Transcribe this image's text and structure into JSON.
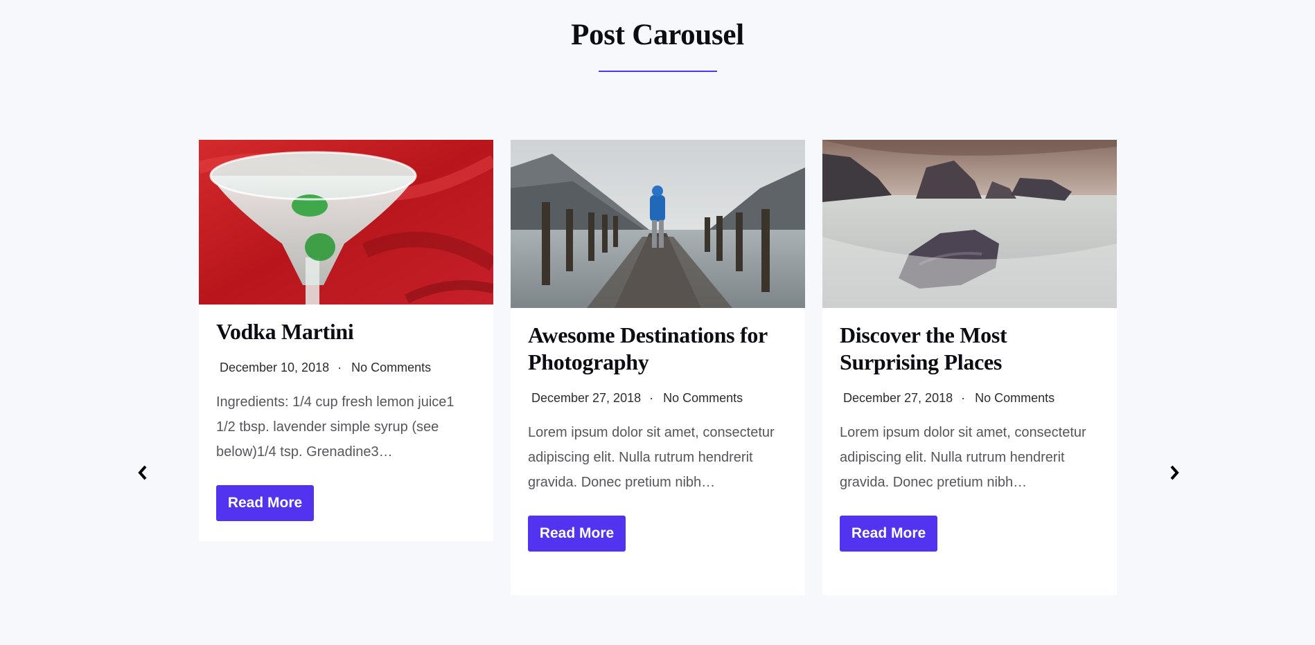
{
  "section": {
    "title": "Post Carousel"
  },
  "navigation": {
    "prev_icon": "chevron-left-icon",
    "next_icon": "chevron-right-icon"
  },
  "posts": [
    {
      "title": "Vodka Martini",
      "date": "December 10, 2018",
      "separator": "·",
      "comments": "No Comments",
      "excerpt": "Ingredients: 1/4 cup fresh lemon juice1 1/2 tbsp. lavender simple syrup (see below)1/4 tsp. Grenadine3…",
      "button_label": "Read More",
      "image": "martini-glass-photo"
    },
    {
      "title": "Awesome Destinations for Photography",
      "date": "December 27, 2018",
      "separator": "·",
      "comments": "No Comments",
      "excerpt": "Lorem ipsum dolor sit amet, consectetur adipiscing elit. Nulla rutrum hendrerit gravida. Donec pretium nibh…",
      "button_label": "Read More",
      "image": "lake-pier-photo"
    },
    {
      "title": "Discover the Most Surprising Places",
      "date": "December 27, 2018",
      "separator": "·",
      "comments": "No Comments",
      "excerpt": "Lorem ipsum dolor sit amet, consectetur adipiscing elit. Nulla rutrum hendrerit gravida. Donec pretium nibh…",
      "button_label": "Read More",
      "image": "rocky-coast-photo"
    }
  ],
  "colors": {
    "accent": "#5133f0",
    "background": "#f6f8fb",
    "card": "#ffffff",
    "heading": "#0c0c14"
  }
}
